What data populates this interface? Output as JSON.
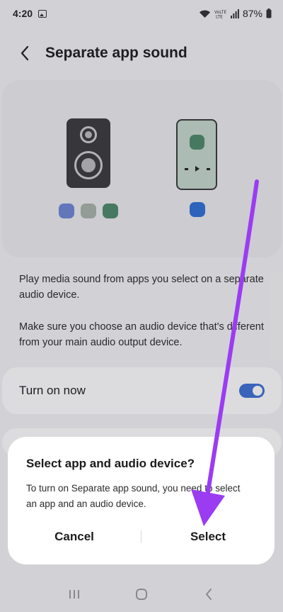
{
  "status_bar": {
    "time": "4:20",
    "battery_percent": "87%",
    "icons": [
      "gallery-icon",
      "wifi-icon",
      "volte-icon",
      "signal-icon",
      "battery-icon"
    ]
  },
  "header": {
    "back_icon": "chevron-left-icon",
    "title": "Separate app sound"
  },
  "illustration": {
    "app_dot_colors": [
      "#6f86d6",
      "#a9b3a9",
      "#4e8a6a"
    ],
    "device_dot_color": "#2f6fd6"
  },
  "description": {
    "line1": "Play media sound from apps you select on a separate audio device.",
    "line2": "Make sure you choose an audio device that's different from your main audio output device."
  },
  "toggle": {
    "label": "Turn on now",
    "state": "on",
    "accent": "#3e6fd4"
  },
  "dialog": {
    "title": "Select app and audio device?",
    "message": "To turn on Separate app sound, you need to select an app and an audio device.",
    "cancel_label": "Cancel",
    "select_label": "Select"
  },
  "nav_bar": {
    "icons": [
      "recents-icon",
      "home-icon",
      "back-icon"
    ]
  },
  "annotation": {
    "arrow_color": "#9b3cf2"
  }
}
